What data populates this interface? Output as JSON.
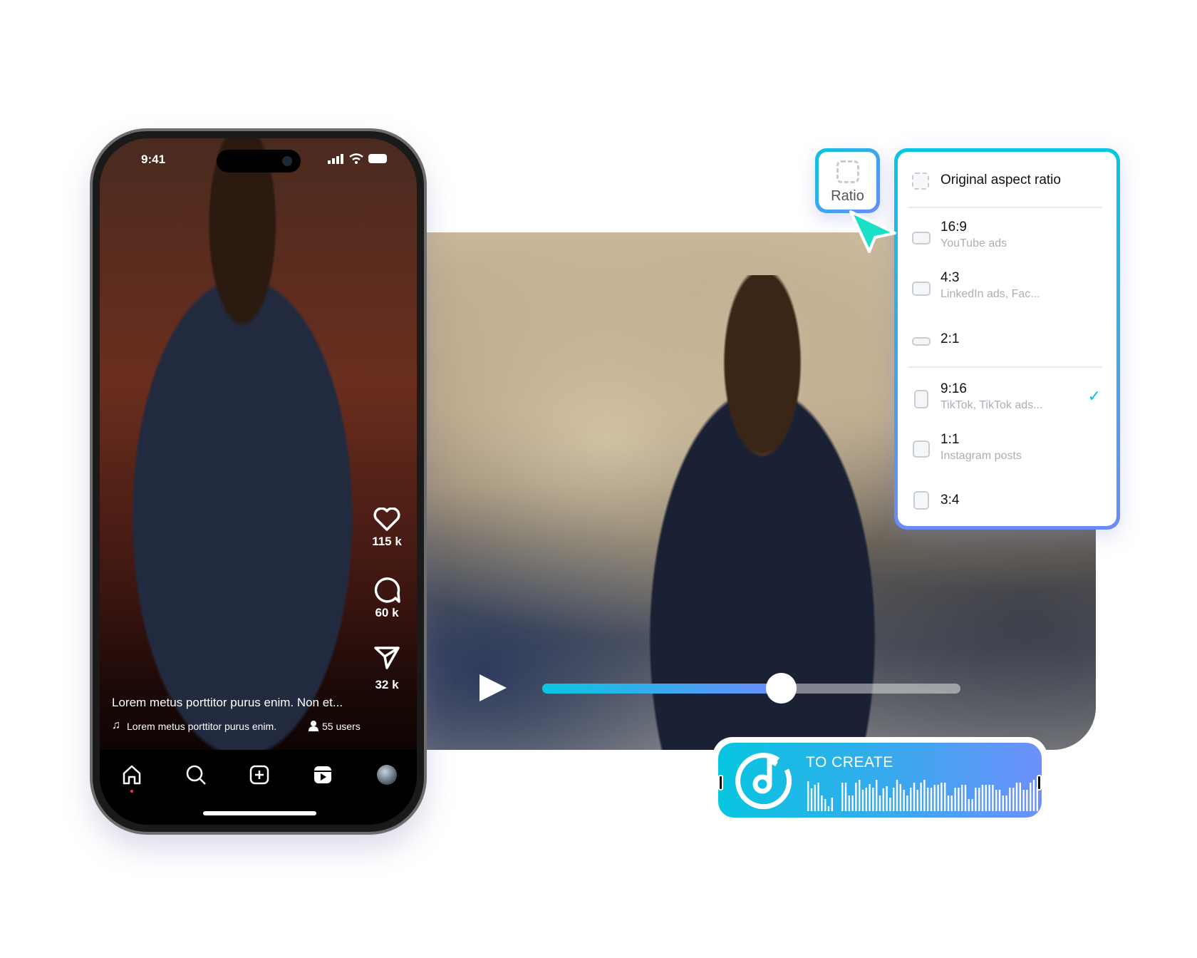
{
  "phone": {
    "status": {
      "time": "9:41",
      "icons": [
        "signal-icon",
        "wifi-icon",
        "battery-icon"
      ]
    },
    "actions": [
      {
        "icon": "heart-icon",
        "count": "115 k"
      },
      {
        "icon": "comment-icon",
        "count": "60 k"
      },
      {
        "icon": "share-icon",
        "count": "32 k"
      }
    ],
    "caption": "Lorem metus porttitor purus enim. Non et...",
    "music": "Lorem metus porttitor purus enim.",
    "users": "55 users",
    "nav": [
      {
        "icon": "home-icon",
        "active": true
      },
      {
        "icon": "search-icon"
      },
      {
        "icon": "add-icon"
      },
      {
        "icon": "reels-icon"
      },
      {
        "icon": "profile-avatar"
      }
    ]
  },
  "player": {
    "progress": 0.57,
    "accent_start": "#08c6e0",
    "accent_end": "#6b8cff"
  },
  "ratio_button": {
    "label": "Ratio"
  },
  "ratio_menu": {
    "header": "Original aspect ratio",
    "options": [
      {
        "ratio": "16:9",
        "desc": "YouTube ads"
      },
      {
        "ratio": "4:3",
        "desc": "LinkedIn ads, Fac..."
      },
      {
        "ratio": "2:1",
        "desc": ""
      },
      {
        "ratio": "9:16",
        "desc": "TikTok, TikTok ads...",
        "selected": true
      },
      {
        "ratio": "1:1",
        "desc": "Instagram posts"
      },
      {
        "ratio": "3:4",
        "desc": ""
      }
    ]
  },
  "music_card": {
    "title": "TO CREATE",
    "icon": "music-note-icon"
  }
}
